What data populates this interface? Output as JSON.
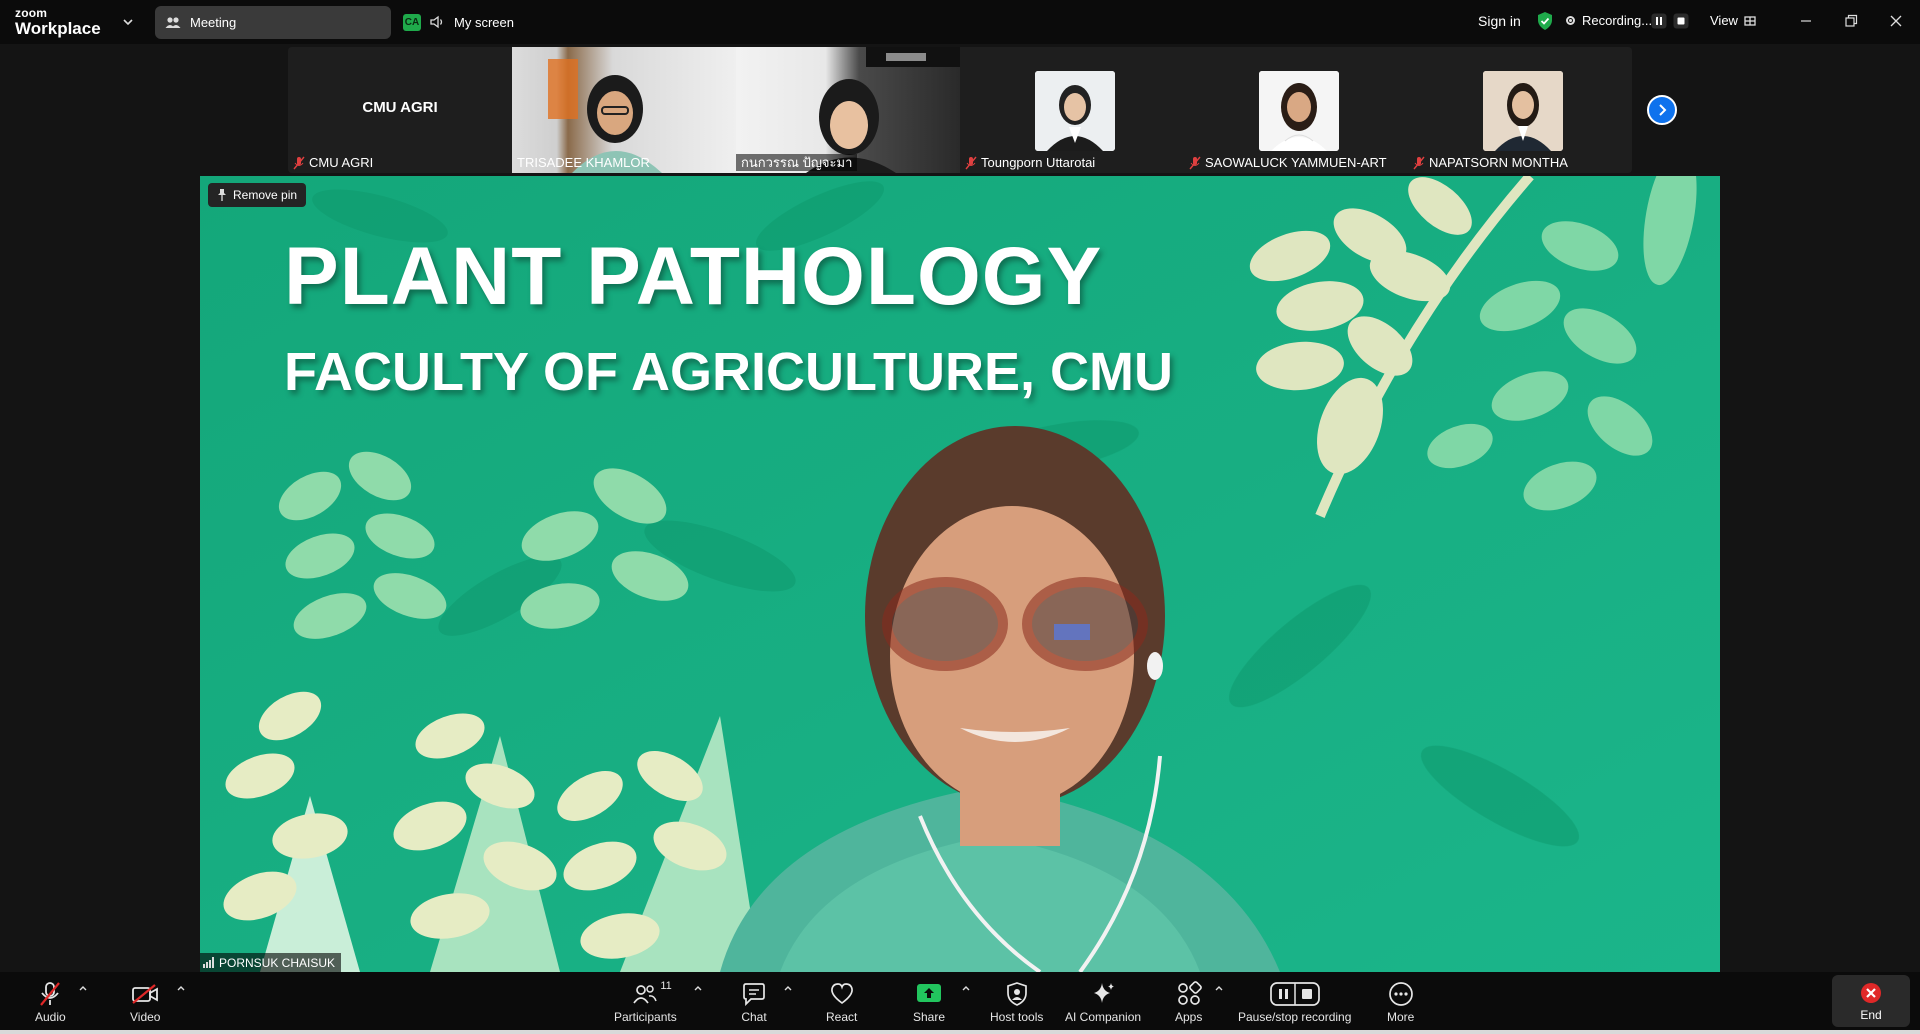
{
  "app": {
    "brand_top": "zoom",
    "brand_bottom": "Workplace"
  },
  "topbar": {
    "meeting_tab": "Meeting",
    "share_badge": "CA",
    "share_label": "My screen",
    "sign_in": "Sign in",
    "recording_status": "Recording...",
    "view_label": "View"
  },
  "thumbnails": [
    {
      "name": "CMU AGRI",
      "center_text": "CMU AGRI",
      "muted": true
    },
    {
      "name": "TRISADEE KHAMLOR",
      "muted": false
    },
    {
      "name": "กนกวรรณ ปัญจะมา",
      "muted": false
    },
    {
      "name": "Toungporn Uttarotai",
      "muted": true
    },
    {
      "name": "SAOWALUCK YAMMUEN-ART",
      "muted": true
    },
    {
      "name": "NAPATSORN MONTHA",
      "muted": true
    }
  ],
  "main": {
    "remove_pin": "Remove pin",
    "slide_title": "PLANT PATHOLOGY",
    "slide_subtitle": "FACULTY OF AGRICULTURE, CMU",
    "speaker_name": "PORNSUK CHAISUK"
  },
  "toolbar": {
    "audio": "Audio",
    "video": "Video",
    "participants": "Participants",
    "participants_count": "11",
    "chat": "Chat",
    "react": "React",
    "share": "Share",
    "host_tools": "Host tools",
    "ai_companion": "AI Companion",
    "apps": "Apps",
    "pause_stop_recording": "Pause/stop recording",
    "more": "More",
    "end": "End"
  },
  "colors": {
    "accent_blue": "#0e72ed",
    "share_green": "#22c55e",
    "end_red": "#e02828",
    "slide_green": "#18a97a"
  }
}
